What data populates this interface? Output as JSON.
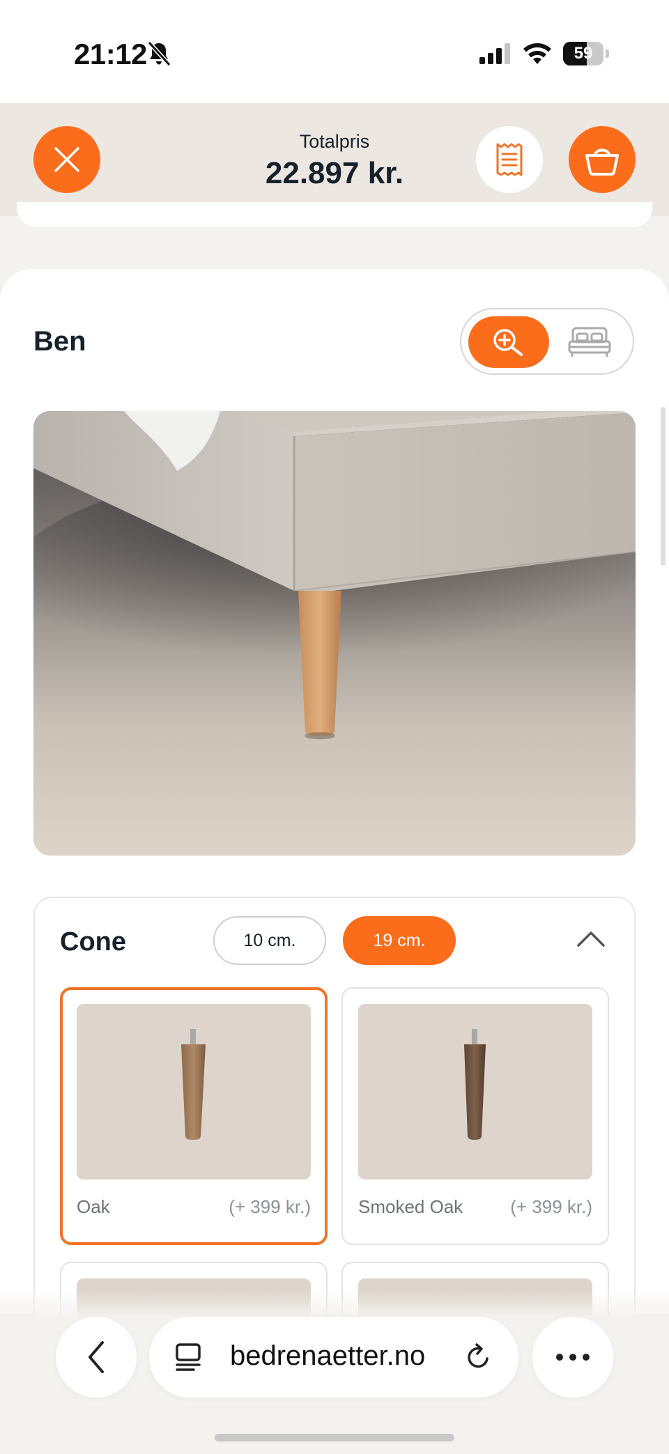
{
  "status_bar": {
    "time": "21:12",
    "battery": "59",
    "battery_level": 0.59,
    "icons": [
      "bell-slash-icon",
      "signal-icon",
      "wifi-icon",
      "battery-icon"
    ]
  },
  "header": {
    "total_label": "Totalpris",
    "total_price": "22.897 kr.",
    "icons": [
      "close-icon",
      "receipt-icon",
      "basket-icon"
    ],
    "accent_color": "#fb6d1b"
  },
  "section": {
    "title": "Ben",
    "view_toggle": {
      "options": [
        "zoom-in-icon",
        "bed-icon"
      ],
      "active": "zoom-in-icon"
    }
  },
  "options": {
    "model": "Cone",
    "sizes": [
      "10 cm.",
      "19 cm."
    ],
    "selected_size": "19 cm.",
    "items": [
      {
        "name": "Oak",
        "price": "(+ 399 kr.)",
        "selected": true
      },
      {
        "name": "Smoked Oak",
        "price": "(+ 399 kr.)",
        "selected": false
      }
    ]
  },
  "browser": {
    "url": "bedrenaetter.no",
    "icons": [
      "back-icon",
      "tabs-icon",
      "reload-icon",
      "more-icon"
    ]
  }
}
